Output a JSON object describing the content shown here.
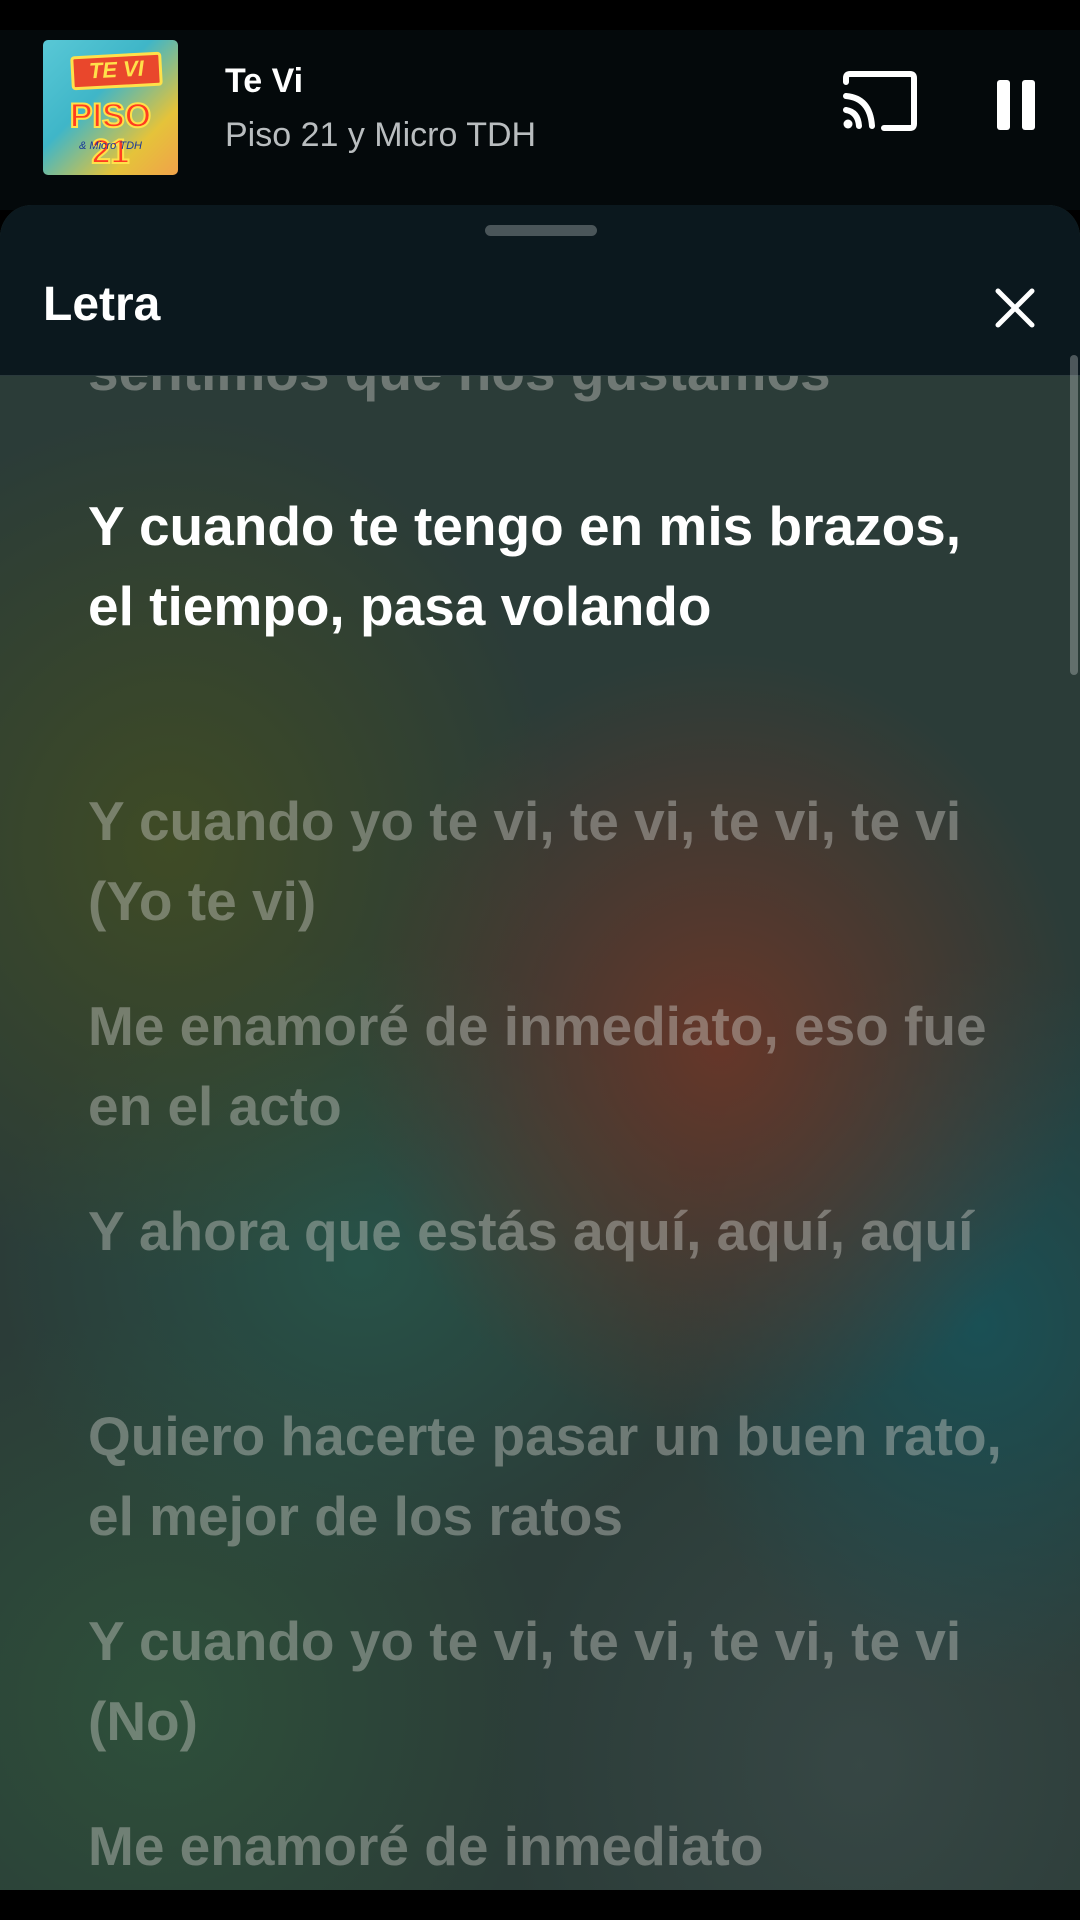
{
  "player": {
    "album_art_text": "TE VI PISO 21 & Micro TDH",
    "title": "Te Vi",
    "artist": "Piso 21 y Micro TDH",
    "icons": {
      "cast": "cast-icon",
      "pause": "pause-icon"
    }
  },
  "lyrics_sheet": {
    "title": "Letra",
    "icons": {
      "close": "close-icon"
    },
    "lines": [
      {
        "text": "sentimos que nos gustamos",
        "active": false
      },
      {
        "text": "Y cuando te tengo en mis brazos, el tiempo, pasa volando",
        "active": true
      },
      {
        "text": "Y cuando yo te vi, te vi, te vi, te vi (Yo te vi)",
        "active": false
      },
      {
        "text": "Me enamoré de inmediato, eso fue en el acto",
        "active": false
      },
      {
        "text": "Y ahora que estás aquí, aquí, aquí",
        "active": false
      },
      {
        "text": "Quiero hacerte pasar un buen rato, el mejor de los ratos",
        "active": false
      },
      {
        "text": "Y cuando yo te vi, te vi, te vi, te vi (No)",
        "active": false
      },
      {
        "text": "Me enamoré de inmediato",
        "active": false
      }
    ]
  }
}
